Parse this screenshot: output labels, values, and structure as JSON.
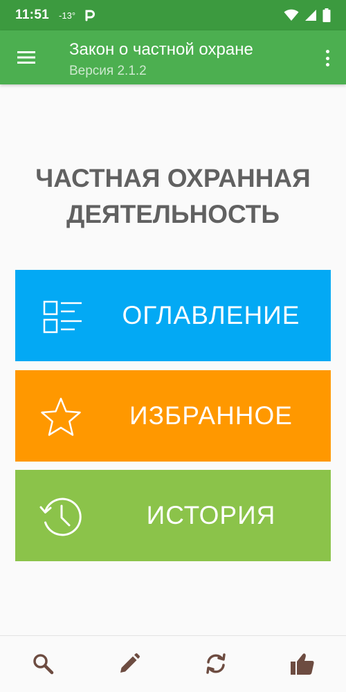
{
  "status_bar": {
    "time": "11:51",
    "temperature": "-13°"
  },
  "app_bar": {
    "title": "Закон о частной охране",
    "subtitle": "Версия 2.1.2"
  },
  "main": {
    "heading_line1": "ЧАСТНАЯ ОХРАННАЯ",
    "heading_line2": "ДЕЯТЕЛЬНОСТЬ",
    "tiles": [
      {
        "label": "ОГЛАВЛЕНИЕ",
        "icon": "list-icon",
        "color": "#03a9f4"
      },
      {
        "label": "ИЗБРАННОЕ",
        "icon": "star-icon",
        "color": "#ff9800"
      },
      {
        "label": "ИСТОРИЯ",
        "icon": "history-icon",
        "color": "#8bc34a"
      }
    ]
  },
  "bottom_bar": {
    "icons": [
      "search-icon",
      "pencil-icon",
      "sync-icon",
      "thumbs-up-icon"
    ],
    "icon_color": "#6d4c41"
  },
  "colors": {
    "status_bar": "#3c9a3f",
    "app_bar": "#4caf50",
    "heading_text": "#616161"
  }
}
